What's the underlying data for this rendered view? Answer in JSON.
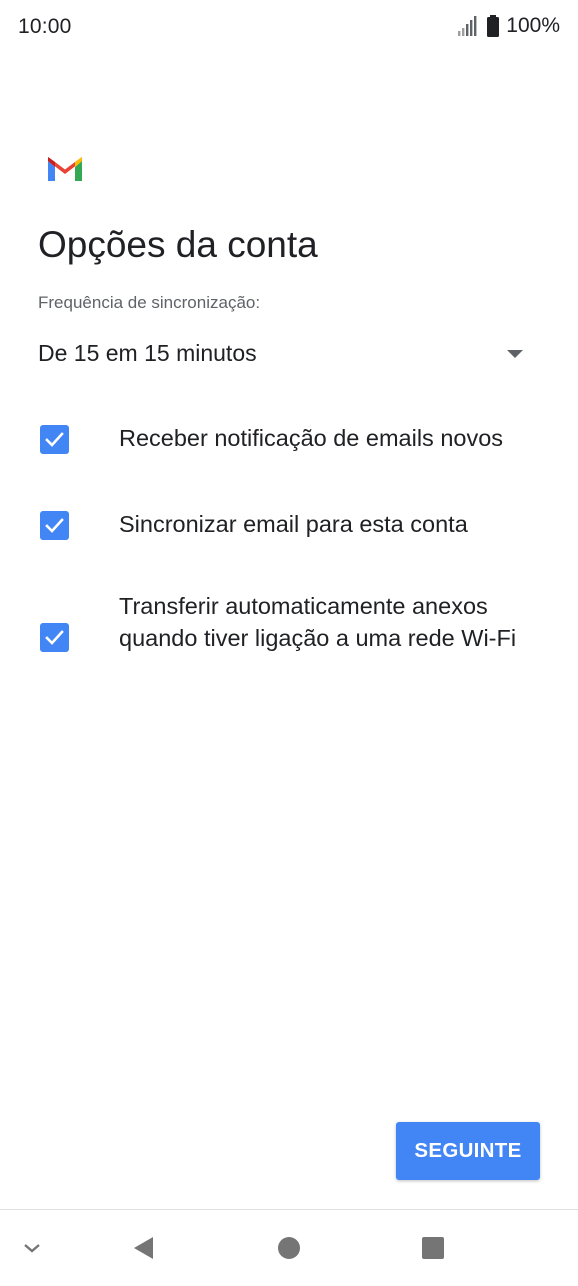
{
  "status_bar": {
    "time": "10:00",
    "battery_percent": "100%",
    "icons": [
      "signal-icon",
      "battery-icon"
    ]
  },
  "app": {
    "logo": "gmail-logo",
    "title": "Opções da conta"
  },
  "sync": {
    "label": "Frequência de sincronização:",
    "selected_value": "De 15 em 15 minutos"
  },
  "options": [
    {
      "label": "Receber notificação de emails novos",
      "checked": true
    },
    {
      "label": "Sincronizar email para esta conta",
      "checked": true
    },
    {
      "label": "Transferir automaticamente anexos quando tiver ligação a uma rede Wi-Fi",
      "checked": true
    }
  ],
  "actions": {
    "next_label": "SEGUINTE"
  },
  "navigation_bar": {
    "icons": [
      "chevron-down-icon",
      "back-icon",
      "home-icon",
      "recents-icon"
    ]
  },
  "colors": {
    "accent": "#4285f4",
    "text_primary": "#202124",
    "text_secondary": "#5f6368",
    "nav_icon": "#757575"
  }
}
